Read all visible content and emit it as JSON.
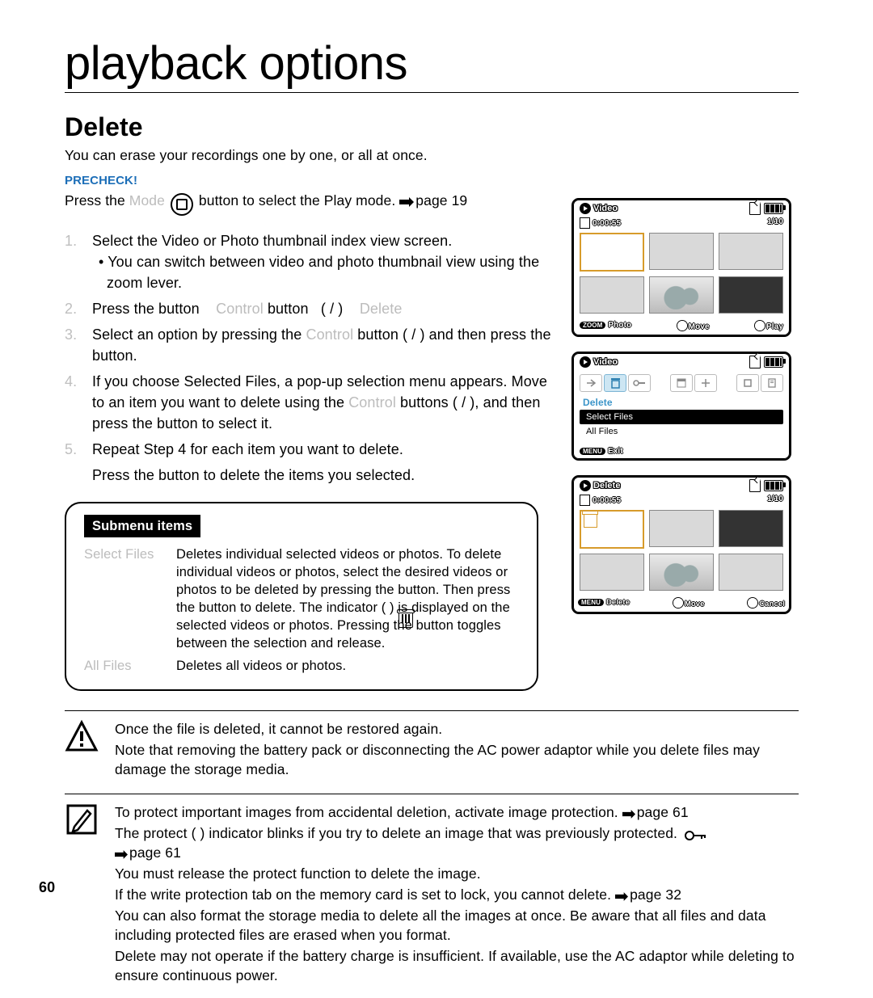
{
  "page_number": "60",
  "chapter_title": "playback options",
  "section_title": "Delete",
  "intro_text": "You can erase your recordings one by one, or all at once.",
  "precheck_label": "PRECHECK!",
  "precheck": {
    "p1": "Press the ",
    "greyed": "Mode",
    "p2": " button to select the Play mode. ",
    "ref": "page 19"
  },
  "steps": {
    "s1": "Select the Video or Photo thumbnail index view screen.",
    "s1b": "You can switch between video and photo thumbnail view using the zoom lever.",
    "s2a": "Press the ",
    "s2b": " button",
    "s2c": "Control",
    "s2d": " button",
    "s2e": "(    /    )",
    "s2f": "Delete",
    "s3a": "Select an option by pressing the ",
    "s3b": "Control",
    "s3c": " button (         /        ) and then press the     button.",
    "s4": "If you choose Selected Files, a pop-up selection menu appears. Move to an item you want to delete using the ",
    "s4b": "Control",
    "s4c": " buttons (     /     ), and then press the     button to select it.",
    "s5a": "Repeat Step 4 for each item you want to delete.",
    "s5b": "Press the      button to delete the items you selected."
  },
  "submenu": {
    "tag": "Submenu items",
    "r1_label": "Select Files",
    "r1_desc": "Deletes individual selected videos or photos. To delete individual videos or photos, select the desired videos or photos to be deleted by pressing the     button. Then press the      button to delete. The indicator (        ) is displayed on the selected videos or photos. Pressing the     button toggles between the selection and release.",
    "r2_label": "All Files",
    "r2_desc": "Deletes all videos or photos."
  },
  "warn": {
    "l1": "Once the file is deleted, it cannot be restored again.",
    "l2": "Note that removing the battery pack or disconnecting the AC power adaptor while you delete files may damage the storage media."
  },
  "note": {
    "l1": "To protect important images from accidental deletion, activate image protection. ",
    "l1ref": "page 61",
    "l2a": "The protect (        ) indicator blinks if you try to delete an image that was previously protected. ",
    "l2ref": "page 61",
    "l3": "You must release the protect function to delete the image.",
    "l4a": "If the write protection tab on the memory card is set to lock, you cannot delete. ",
    "l4ref": "page 32",
    "l5": "You can also format the storage media to delete all the images at once. Be aware that all files and data including protected files are erased when you format.",
    "l6": "Delete may not operate if the battery charge is insufficient. If available, use the AC adaptor while deleting to ensure continuous power."
  },
  "lcd": {
    "video_label": "Video",
    "time": "0:00:55",
    "count": "1/10",
    "zoom": "ZOOM",
    "photo": "Photo",
    "move": "Move",
    "play": "Play",
    "menu": "MENU",
    "exit": "Exit",
    "delete_label": "Delete",
    "select_files": "Select Files",
    "all_files": "All Files",
    "cancel": "Cancel"
  }
}
